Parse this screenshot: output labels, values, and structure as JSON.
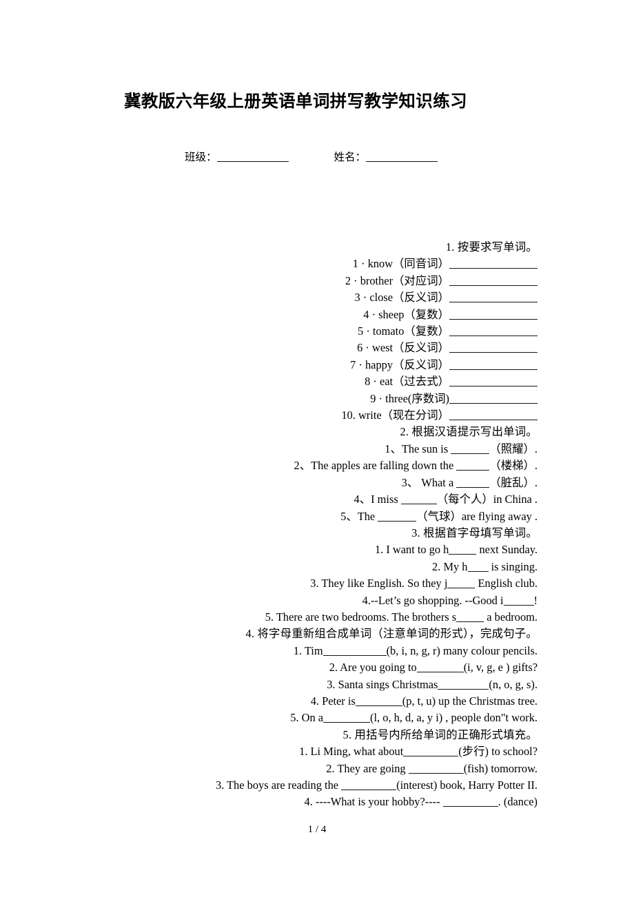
{
  "document": {
    "title": "冀教版六年级上册英语单词拼写教学知识练习",
    "footer_page": "1 / 4"
  },
  "header_fields": {
    "class_label": "班级：",
    "name_label": "姓名："
  },
  "sections": [
    {
      "heading": "1. 按要求写单词。",
      "items": [
        {
          "num": "1 ·",
          "text": "know（同音词）",
          "blank": "w128"
        },
        {
          "num": "2 ·",
          "text": "brother（对应词）",
          "blank": "w128"
        },
        {
          "num": "3 ·",
          "text": "close（反义词）",
          "blank": "w128"
        },
        {
          "num": "4 ·",
          "text": "sheep（复数）",
          "blank": "w128"
        },
        {
          "num": "5 ·",
          "text": "tomato（复数）",
          "blank": "w128"
        },
        {
          "num": "6 ·",
          "text": "west（反义词）",
          "blank": "w128"
        },
        {
          "num": "7 ·",
          "text": "happy（反义词）",
          "blank": "w128"
        },
        {
          "num": "8 ·",
          "text": "eat（过去式）",
          "blank": "w128"
        },
        {
          "num": "9 ·",
          "text": "three(序数词)",
          "blank": "w128"
        },
        {
          "num": "10.",
          "text": "write（现在分词）",
          "blank": "w128"
        }
      ]
    },
    {
      "heading": "2. 根据汉语提示写出单词。",
      "items": [
        {
          "pre": "1、The sun is ",
          "blank": "w56",
          "post": "（照耀）."
        },
        {
          "pre": "2、The apples are falling down the ",
          "blank": "w48",
          "post": "（楼梯）."
        },
        {
          "pre": "3、 What a ",
          "blank": "w48",
          "post": "（脏乱）."
        },
        {
          "pre": "4、I miss ",
          "blank": "w52",
          "post": "（每个人）in China ."
        },
        {
          "pre": "5、The ",
          "blank": "w56",
          "post": "（气球）are flying away ."
        }
      ]
    },
    {
      "heading": "3. 根据首字母填写单词。",
      "items": [
        {
          "pre": "1. I want to go h",
          "blank": "w40",
          "post": " next Sunday."
        },
        {
          "pre": "2. My h",
          "blank": "w30",
          "post": " is singing."
        },
        {
          "pre": "3. They like English. So they j",
          "blank": "w40",
          "post": " English club."
        },
        {
          "pre": "4.--Let’s go shopping. --Good i",
          "blank": "w44",
          "post": "!"
        },
        {
          "pre": "5. There are two bedrooms. The brothers s",
          "blank": "w40",
          "post": " a bedroom."
        }
      ]
    },
    {
      "heading": "4. 将字母重新组合成单词（注意单词的形式），完成句子。",
      "items": [
        {
          "pre": "1. Tim",
          "blank": "w92",
          "post": "(b, i, n, g, r) many colour pencils."
        },
        {
          "pre": "2. Are you going to",
          "blank": "w68",
          "post": "(i, v, g, e ) gifts?"
        },
        {
          "pre": "3. Santa sings Christmas",
          "blank": "w74",
          "post": "(n, o, g, s)."
        },
        {
          "pre": "4. Peter is",
          "blank": "w68",
          "post": "(p, t, u) up the Christmas tree."
        },
        {
          "pre": "5. On a",
          "blank": "w68",
          "post": "(l, o, h, d, a, y i) , people don\"t work."
        }
      ]
    },
    {
      "heading": "5. 用括号内所给单词的正确形式填充。",
      "items": [
        {
          "pre": "1. Li Ming, what about",
          "blank": "w80",
          "post": "(步行) to school?"
        },
        {
          "pre": "2. They are going ",
          "blank": "w80",
          "post": "(fish) tomorrow."
        },
        {
          "pre": "3. The boys are reading the ",
          "blank": "w80",
          "post": "(interest) book, Harry Potter II."
        },
        {
          "pre": "4. ----What is your hobby?---- ",
          "blank": "w80",
          "post": ". (dance)"
        }
      ]
    }
  ]
}
